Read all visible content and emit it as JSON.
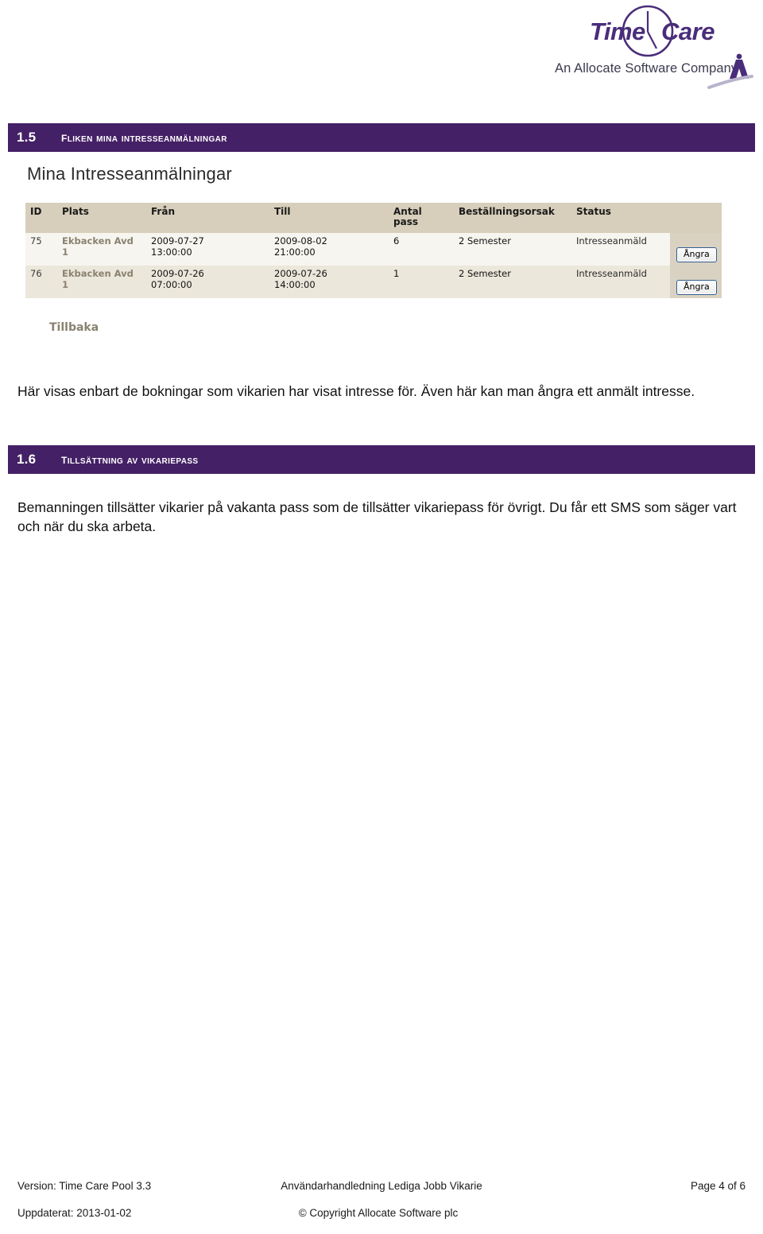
{
  "logo": {
    "brand_primary": "Time",
    "brand_secondary": "Care",
    "tagline": "An Allocate Software Company",
    "color": "#4a2d7a"
  },
  "sections": [
    {
      "number": "1.5",
      "title": "Fliken Mina intresseanmälningar",
      "body": "Här visas enbart de bokningar som vikarien har visat intresse för. Även här kan man ångra ett anmält intresse."
    },
    {
      "number": "1.6",
      "title": "Tillsättning av vikariepass",
      "body": "Bemanningen tillsätter vikarier på vakanta pass som de tillsätter vikariepass för övrigt. Du får ett SMS som säger vart och när du ska arbeta."
    }
  ],
  "screenshot": {
    "title": "Mina Intresseanmälningar",
    "back_link": "Tillbaka",
    "columns": [
      "ID",
      "Plats",
      "Från",
      "Till",
      "Antal pass",
      "Beställningsorsak",
      "Status",
      ""
    ],
    "rows": [
      {
        "id": "75",
        "plats": "Ekbacken Avd 1",
        "fran": "2009-07-27\n13:00:00",
        "till": "2009-08-02\n21:00:00",
        "antal_pass": "6",
        "bestallningsorsak": "2 Semester",
        "status": "Intresseanmäld",
        "action": "Ångra"
      },
      {
        "id": "76",
        "plats": "Ekbacken Avd 1",
        "fran": "2009-07-26\n07:00:00",
        "till": "2009-07-26\n14:00:00",
        "antal_pass": "1",
        "bestallningsorsak": "2 Semester",
        "status": "Intresseanmäld",
        "action": "Ångra"
      }
    ]
  },
  "footer": {
    "version": "Version: Time Care Pool 3.3",
    "doc_title": "Användarhandledning Lediga Jobb Vikarie",
    "page": "Page 4 of 6",
    "updated": "Uppdaterat: 2013-01-02",
    "copyright": "© Copyright Allocate Software plc"
  }
}
